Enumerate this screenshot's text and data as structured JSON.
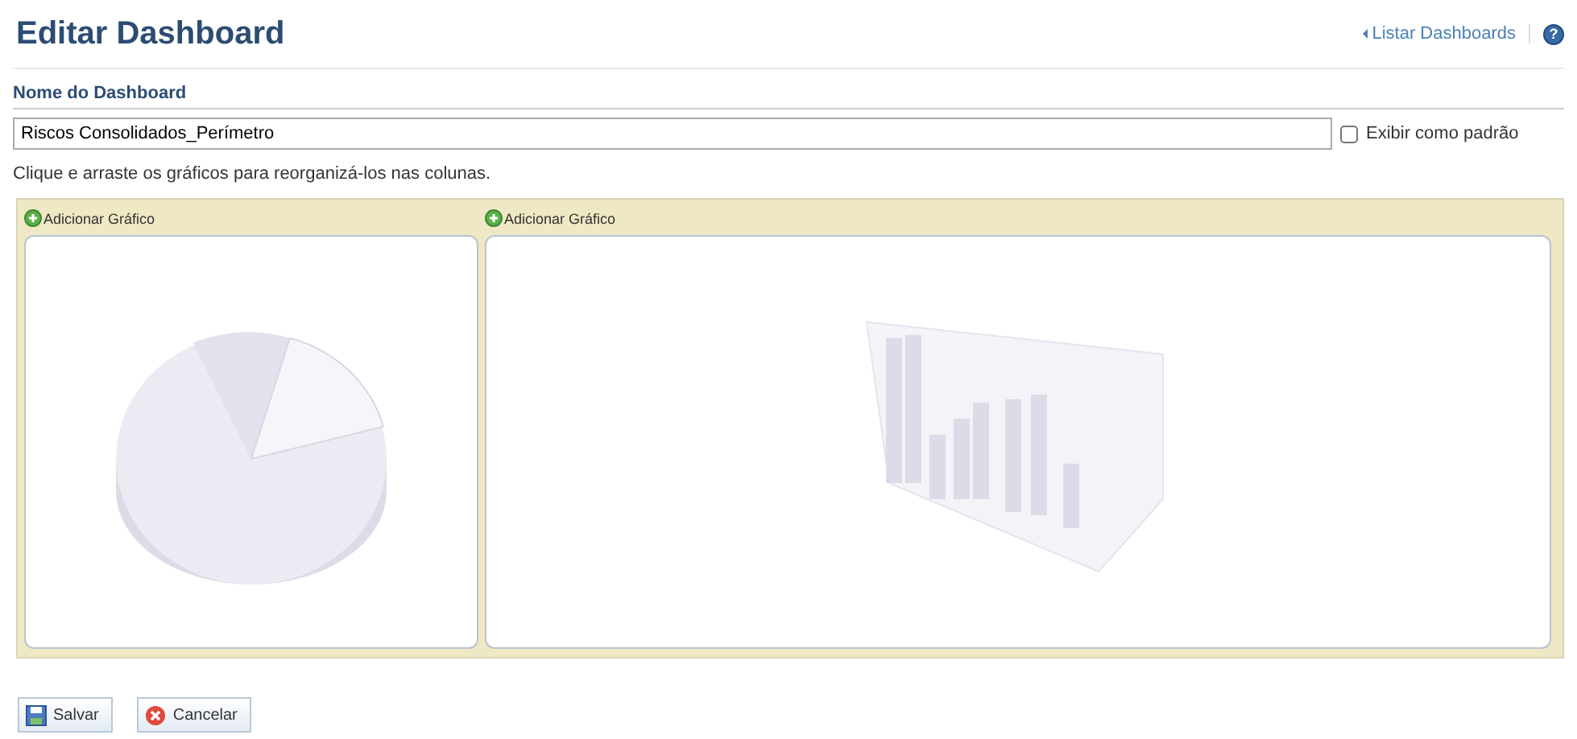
{
  "page": {
    "title": "Editar Dashboard",
    "back_link": "Listar Dashboards",
    "help": "?"
  },
  "form": {
    "name_label": "Nome do Dashboard",
    "name_value": "Riscos Consolidados_Perímetro",
    "default_checkbox": {
      "label": "Exibir como padrão",
      "checked": false
    },
    "hint": "Clique e arraste os gráficos para reorganizá-los nas colunas."
  },
  "columns": [
    {
      "add_label": "Adicionar Gráfico",
      "kind": "pie"
    },
    {
      "add_label": "Adicionar Gráfico",
      "kind": "bar"
    }
  ],
  "buttons": [
    {
      "kind": "save",
      "label": "Salvar"
    },
    {
      "kind": "cancel",
      "label": "Cancelar"
    }
  ]
}
